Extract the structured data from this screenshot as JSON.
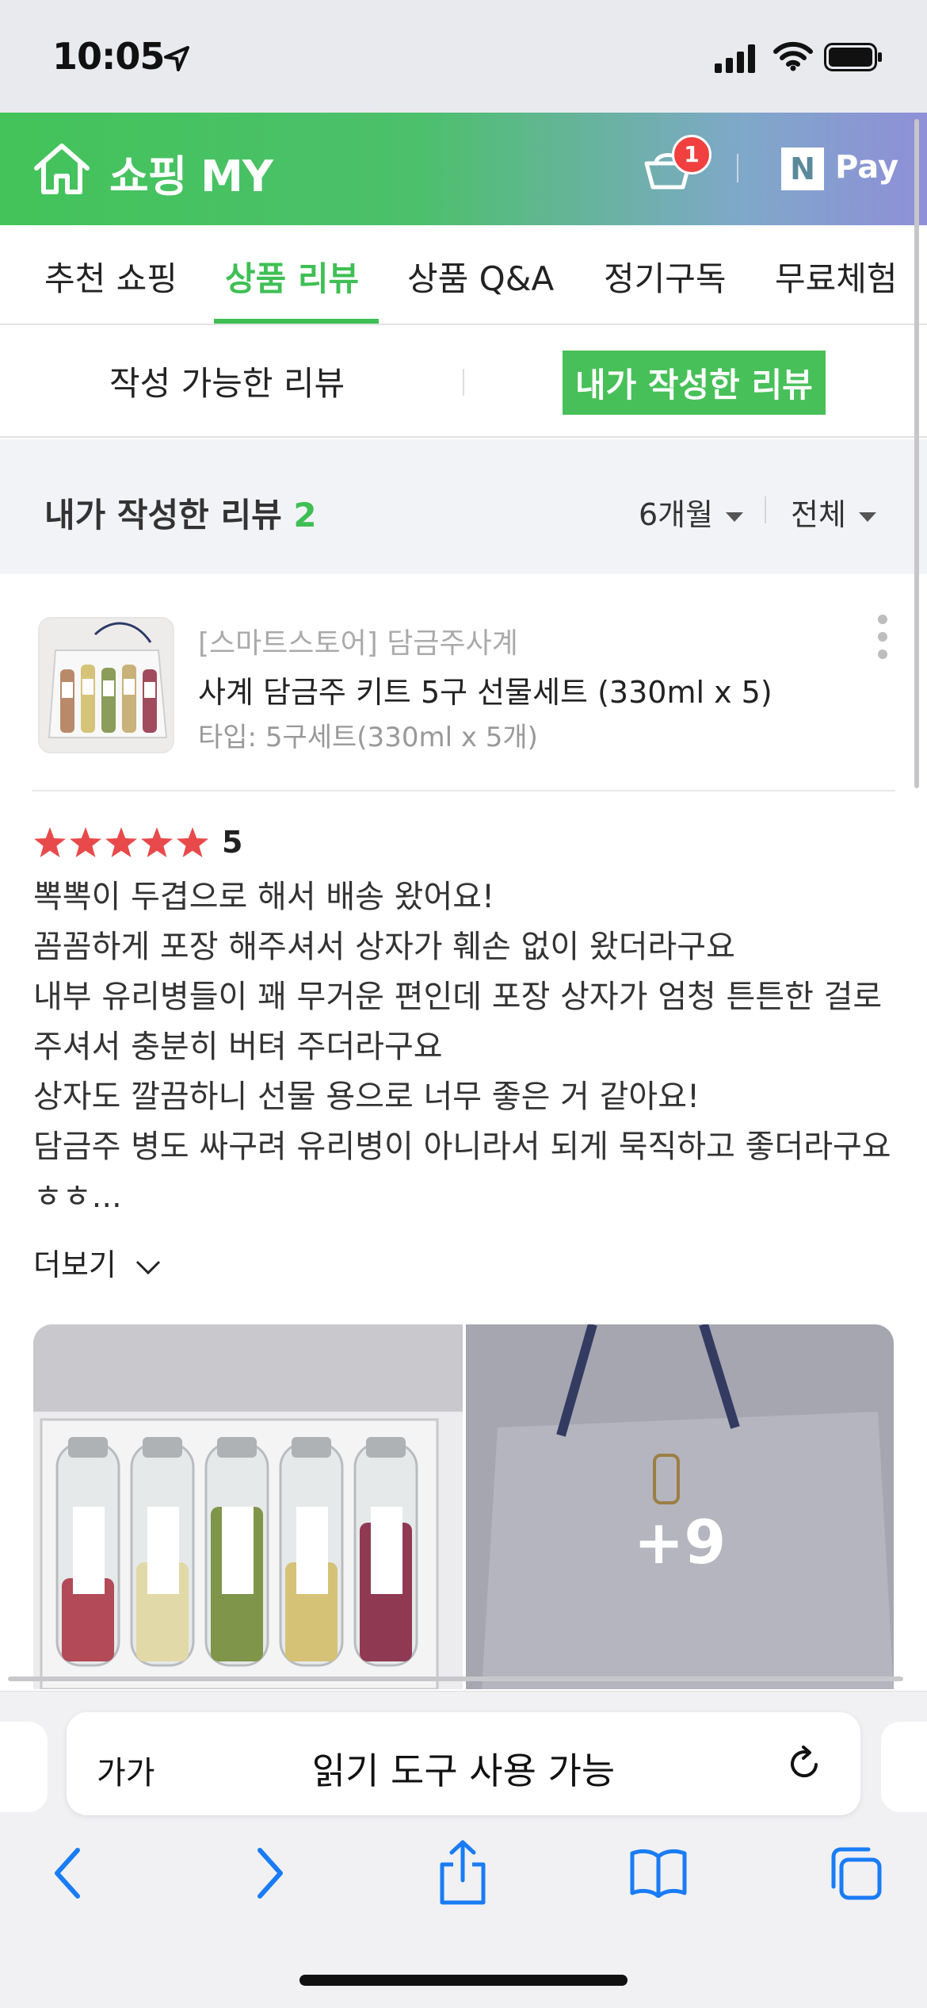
{
  "status_bar": {
    "time": "10:05"
  },
  "header": {
    "title": "쇼핑 MY",
    "cart_count": "1",
    "pay_logo_letter": "N",
    "pay_label": "Pay"
  },
  "main_tabs": [
    {
      "label": "추천 쇼핑"
    },
    {
      "label": "상품 리뷰"
    },
    {
      "label": "상품 Q&A"
    },
    {
      "label": "정기구독"
    },
    {
      "label": "무료체험"
    }
  ],
  "sub_tabs": {
    "writable": "작성 가능한 리뷰",
    "written": "내가 작성한 리뷰"
  },
  "review_summary": {
    "label": "내가 작성한 리뷰",
    "count": "2",
    "period_filter": "6개월",
    "type_filter": "전체"
  },
  "product": {
    "store": "[스마트스토어] 담금주사계",
    "name": "사계 담금주 키트 5구 선물세트 (330ml x 5)",
    "option": "타입: 5구세트(330ml x 5개)"
  },
  "review": {
    "rating": "5",
    "lines": [
      "뽁뽁이 두겹으로 해서 배송 왔어요!",
      "꼼꼼하게 포장 해주셔서 상자가 훼손 없이 왔더라구요",
      "내부 유리병들이 꽤 무거운 편인데 포장 상자가 엄청 튼튼한 걸로 주셔서 충분히 버텨 주더라구요",
      "상자도 깔끔하니 선물 용으로 너무 좋은 거 같아요!",
      "담금주 병도 싸구려 유리병이 아니라서 되게 묵직하고 좋더라구요 ㅎㅎ..."
    ],
    "more_label": "더보기",
    "extra_photos": "+9"
  },
  "safari": {
    "text_size_button": "가가",
    "address_text": "읽기 도구 사용 가능"
  },
  "colors": {
    "accent": "#3fbf55",
    "badge": "#f04040",
    "star": "#e8494a",
    "ios_blue": "#1a7cf5"
  }
}
